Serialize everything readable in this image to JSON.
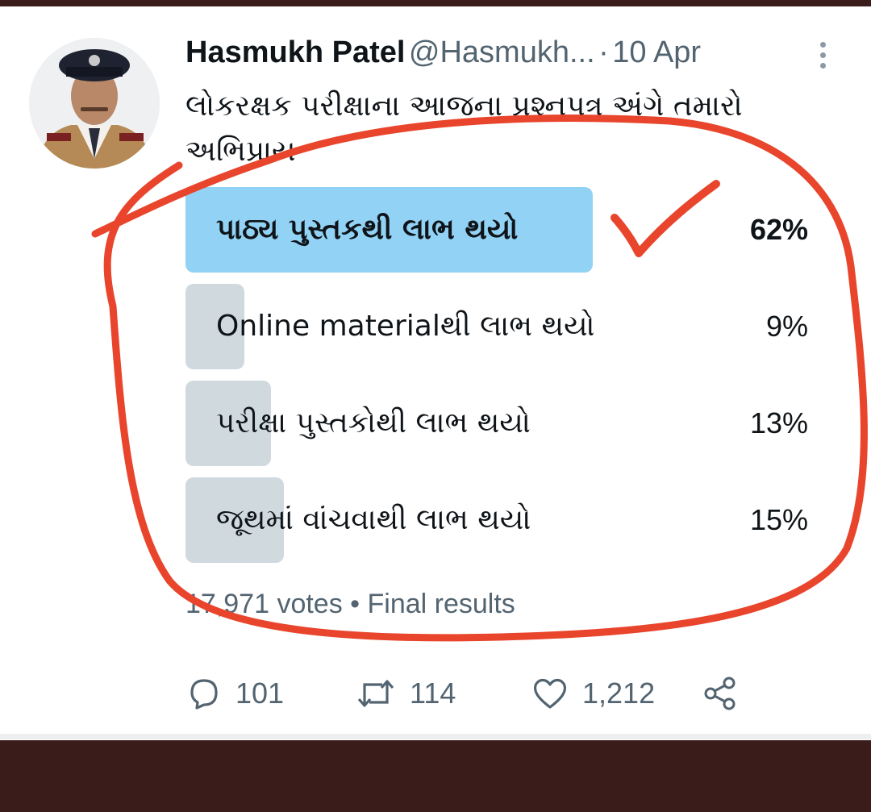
{
  "tweet": {
    "author_name": "Hasmukh Patel",
    "author_handle": "@Hasmukh...",
    "separator": "·",
    "date": "10 Apr",
    "text": "લોકરક્ષક પરીક્ષાના આજના પ્રશ્નપત્ર અંગે તમારો અભિપ્રાય"
  },
  "poll": {
    "options": [
      {
        "label": "પાઠ્ય પુસ્તકથી લાભ થયો",
        "percent_text": "62%",
        "percent": 62,
        "winner": true
      },
      {
        "label": "Online materialથી લાભ થયો",
        "percent_text": "9%",
        "percent": 9,
        "winner": false
      },
      {
        "label": "પરીક્ષા પુસ્તકોથી લાભ થયો",
        "percent_text": "13%",
        "percent": 13,
        "winner": false
      },
      {
        "label": "જૂથમાં વાંચવાથી લાભ થયો",
        "percent_text": "15%",
        "percent": 15,
        "winner": false
      }
    ],
    "votes_text": "17,971 votes • Final results"
  },
  "actions": {
    "replies": "101",
    "retweets": "114",
    "likes": "1,212"
  },
  "icons": {
    "reply": "reply-icon",
    "retweet": "retweet-icon",
    "like": "heart-icon",
    "share": "share-icon",
    "more": "more-icon",
    "check": "checkmark-icon"
  },
  "colors": {
    "winner_bar": "#92d2f5",
    "option_bar": "#cfd9de",
    "annotation": "#e8452c",
    "frame": "#3a1d1a"
  }
}
